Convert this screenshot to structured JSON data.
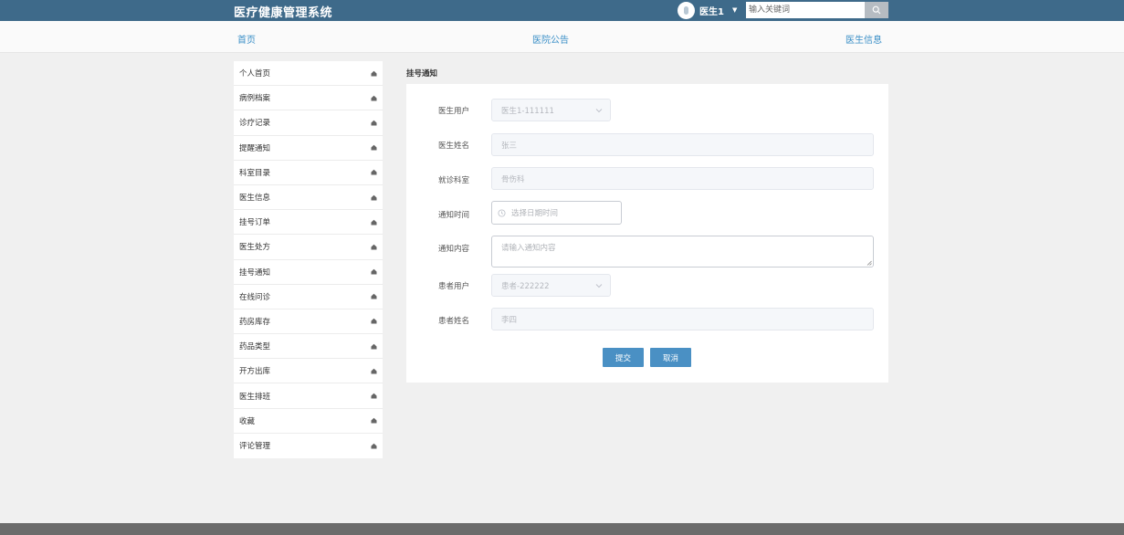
{
  "header": {
    "brand": "医疗健康管理系统",
    "user_name": "医生1",
    "search_placeholder": "输入关键词"
  },
  "nav": {
    "home": "首页",
    "announcement": "医院公告",
    "doctor_info": "医生信息"
  },
  "sidebar": {
    "items": [
      {
        "label": "个人首页"
      },
      {
        "label": "病例档案"
      },
      {
        "label": "诊疗记录"
      },
      {
        "label": "提醒通知"
      },
      {
        "label": "科室目录"
      },
      {
        "label": "医生信息"
      },
      {
        "label": "挂号订单"
      },
      {
        "label": "医生处方"
      },
      {
        "label": "挂号通知"
      },
      {
        "label": "在线问诊"
      },
      {
        "label": "药房库存"
      },
      {
        "label": "药品类型"
      },
      {
        "label": "开方出库"
      },
      {
        "label": "医生排班"
      },
      {
        "label": "收藏"
      },
      {
        "label": "评论管理"
      }
    ]
  },
  "page": {
    "title": "挂号通知"
  },
  "form": {
    "doctor_user_label": "医生用户",
    "doctor_user_value": "医生1-111111",
    "doctor_name_label": "医生姓名",
    "doctor_name_value": "张三",
    "department_label": "就诊科室",
    "department_value": "骨伤科",
    "notify_time_label": "通知时间",
    "notify_time_placeholder": "选择日期时间",
    "notify_content_label": "通知内容",
    "notify_content_placeholder": "请输入通知内容",
    "patient_user_label": "患者用户",
    "patient_user_value": "患者-222222",
    "patient_name_label": "患者姓名",
    "patient_name_value": "李四",
    "submit_label": "提交",
    "cancel_label": "取消"
  },
  "colors": {
    "topbar": "#3e6a8a",
    "nav_link": "#3a8fc7",
    "button": "#4a90c4"
  }
}
